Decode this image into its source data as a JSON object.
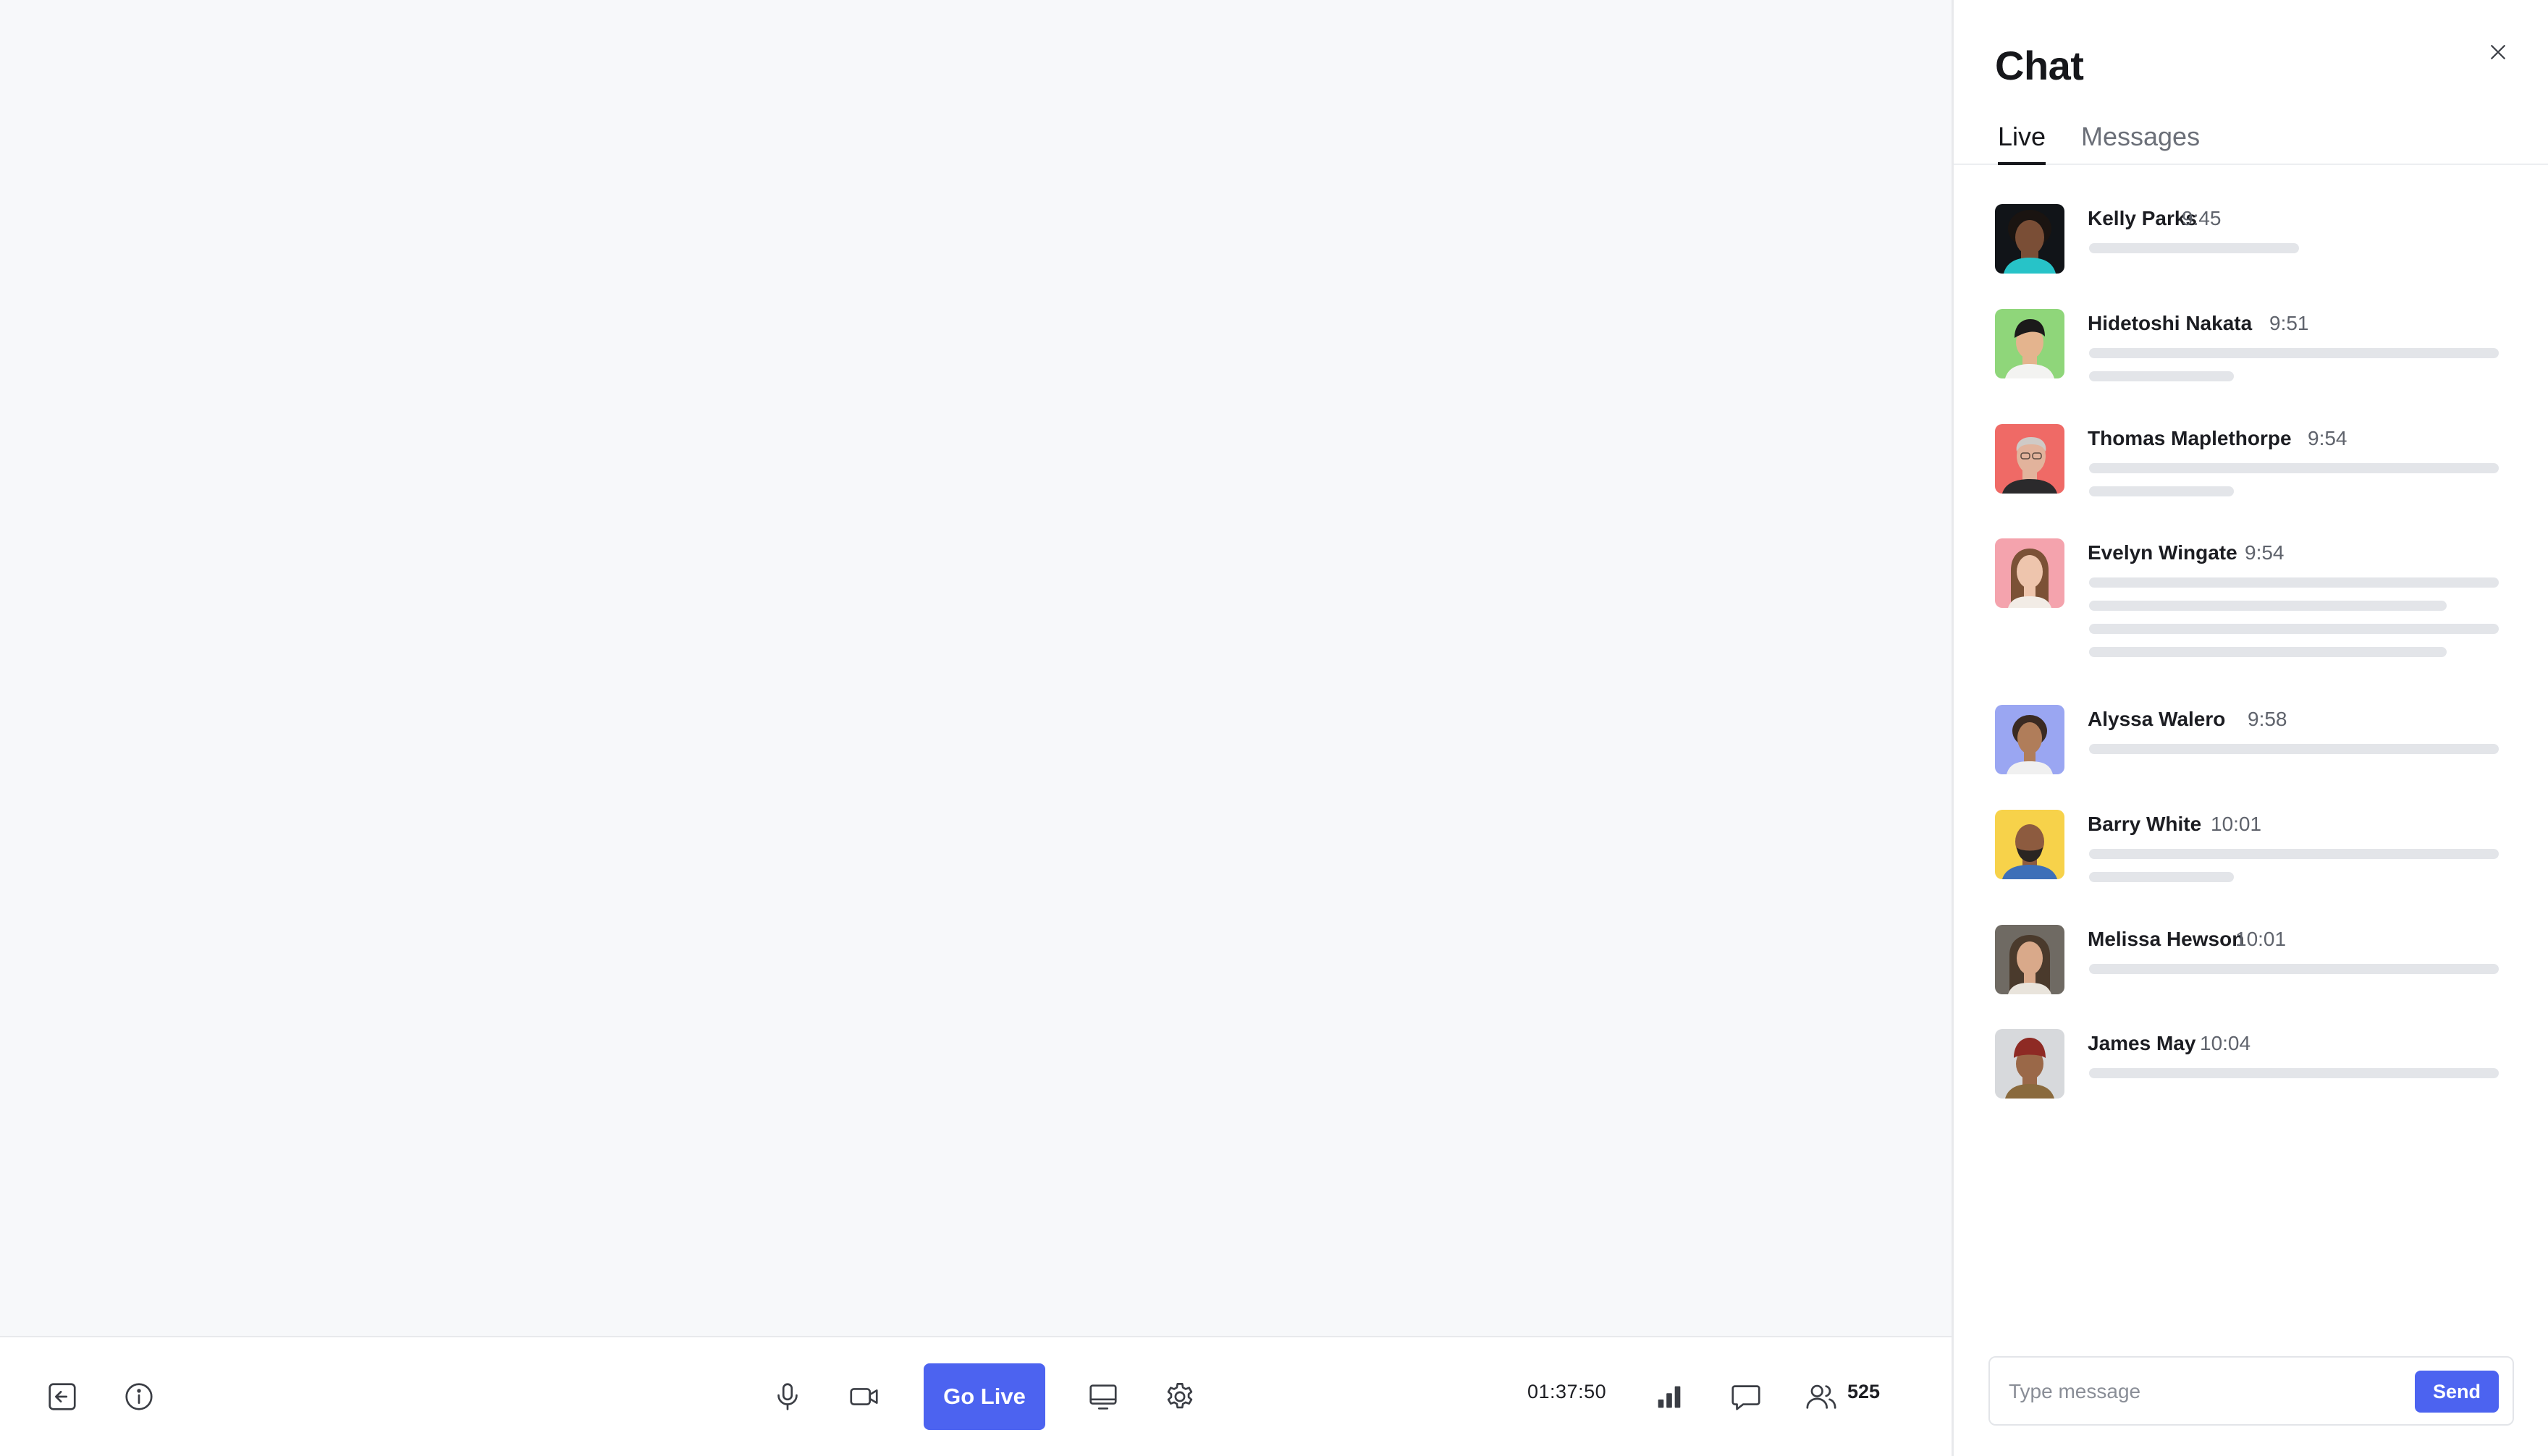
{
  "toolbar": {
    "go_live_label": "Go Live",
    "timer": "01:37:50",
    "viewer_count": "525",
    "icons": [
      "exit-icon",
      "info-icon",
      "microphone-icon",
      "camera-icon",
      "screen-share-icon",
      "settings-icon",
      "stats-icon",
      "chat-icon",
      "participants-icon"
    ]
  },
  "chat": {
    "title": "Chat",
    "tabs": [
      {
        "label": "Live",
        "active": true
      },
      {
        "label": "Messages",
        "active": false
      }
    ],
    "messages": [
      {
        "name": "Kelly Parks",
        "time": "9:45",
        "avatar_bg": "#111418",
        "skin": "#7a4e36",
        "hair": "#1a1411"
      },
      {
        "name": "Hidetoshi Nakata",
        "time": "9:51",
        "avatar_bg": "#8fd67a",
        "skin": "#e4b48e",
        "hair": "#1b1a1a"
      },
      {
        "name": "Thomas Maplethorpe",
        "time": "9:54",
        "avatar_bg": "#ef6a66",
        "skin": "#e2b39c",
        "hair": "#cfcac6"
      },
      {
        "name": "Evelyn Wingate",
        "time": "9:54",
        "avatar_bg": "#f4a3ad",
        "skin": "#eec5ad",
        "hair": "#7b5136"
      },
      {
        "name": "Alyssa Walero",
        "time": "9:58",
        "avatar_bg": "#9aa6f2",
        "skin": "#b07d5a",
        "hair": "#3a2a22"
      },
      {
        "name": "Barry White",
        "time": "10:01",
        "avatar_bg": "#f7d24a",
        "skin": "#8d5b3f",
        "hair": "#2a2522"
      },
      {
        "name": "Melissa Hewson",
        "time": "10:01",
        "avatar_bg": "#6f6a63",
        "skin": "#d9a98a",
        "hair": "#4a3a2c"
      },
      {
        "name": "James May",
        "time": "10:04",
        "avatar_bg": "#d7d9dc",
        "skin": "#9a6848",
        "hair": "#8e2a24"
      }
    ],
    "composer": {
      "placeholder": "Type message",
      "value": "",
      "send_label": "Send"
    }
  },
  "colors": {
    "accent": "#4c63f0",
    "stage_bg": "#f7f8fa",
    "placeholder_bar": "#e3e5e9"
  }
}
